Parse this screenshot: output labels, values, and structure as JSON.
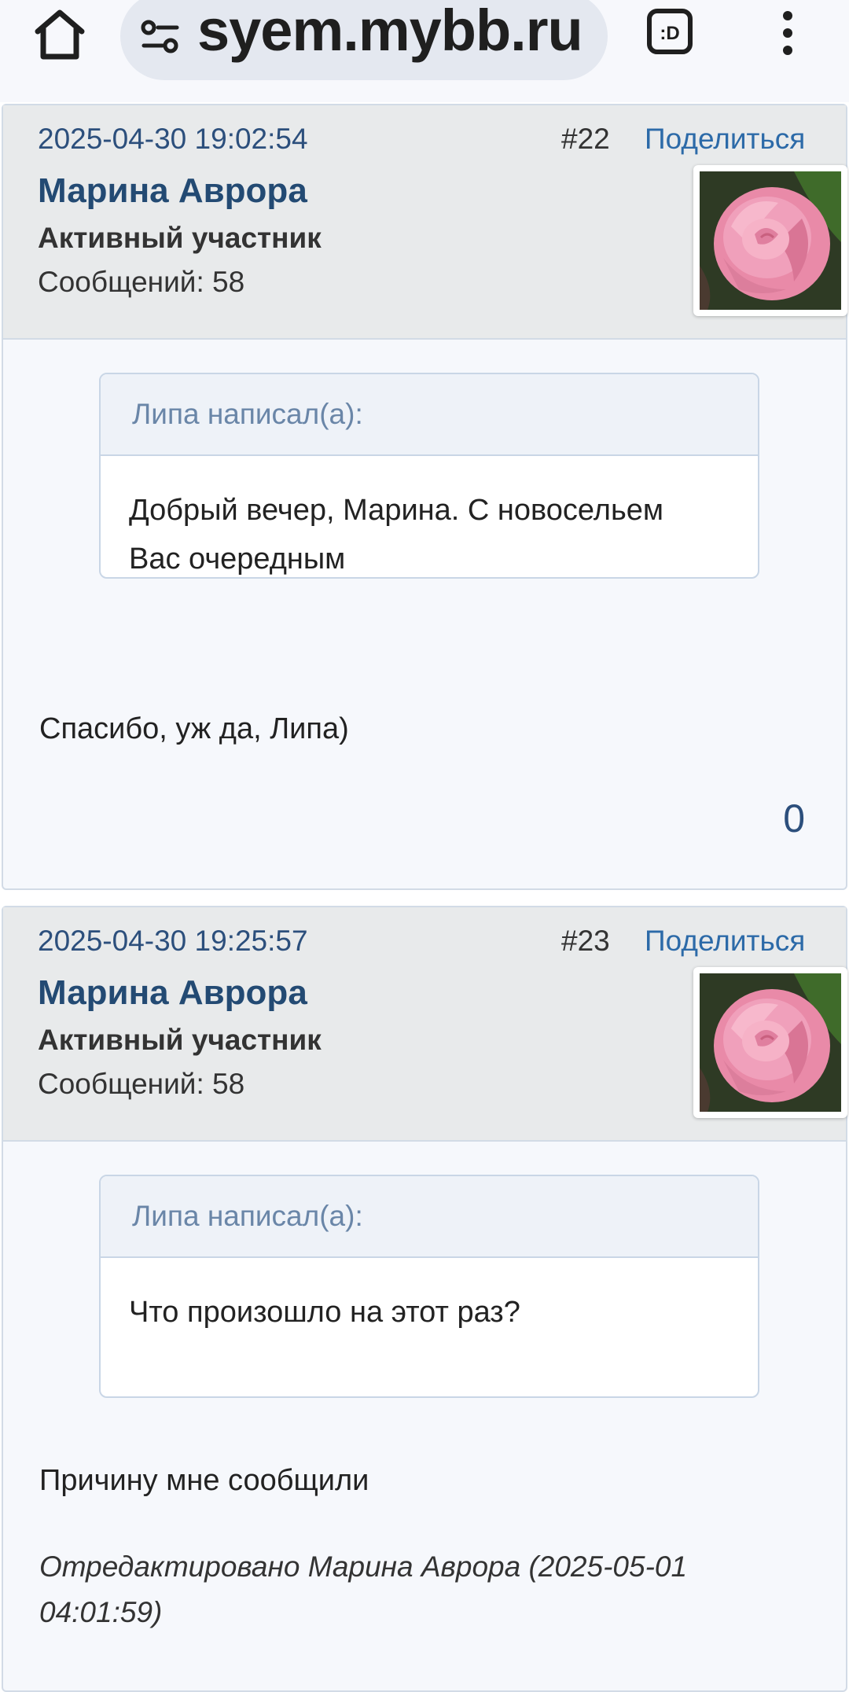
{
  "browser": {
    "url": "syem.mybb.ru",
    "tabs_label": ":D"
  },
  "posts": [
    {
      "date": "2025-04-30 19:02:54",
      "number": "#22",
      "share": "Поделиться",
      "author": "Марина Аврора",
      "rank": "Активный участник",
      "messages": "Сообщений: 58",
      "quote_header": "Липа написал(а):",
      "quote_line1": "Добрый вечер, Марина. С новосельем",
      "quote_line2": "Вас очередным",
      "text": "Спасибо, уж да, Липа)",
      "rating": "0"
    },
    {
      "date": "2025-04-30 19:25:57",
      "number": "#23",
      "share": "Поделиться",
      "author": "Марина Аврора",
      "rank": "Активный участник",
      "messages": "Сообщений: 58",
      "quote_header": "Липа написал(а):",
      "quote_line1": "Что произошло на этот раз?",
      "text": "Причину мне сообщили",
      "edited_line1": "Отредактировано Марина Аврора (2025-05-01",
      "edited_line2": "04:01:59)"
    }
  ],
  "colors": {
    "link": "#2c6aa8",
    "author": "#234a73",
    "header_bg": "#e8eaeb"
  },
  "icons": [
    "home-icon",
    "site-settings-icon",
    "tabs-icon",
    "more-vert-icon",
    "rose-avatar"
  ]
}
